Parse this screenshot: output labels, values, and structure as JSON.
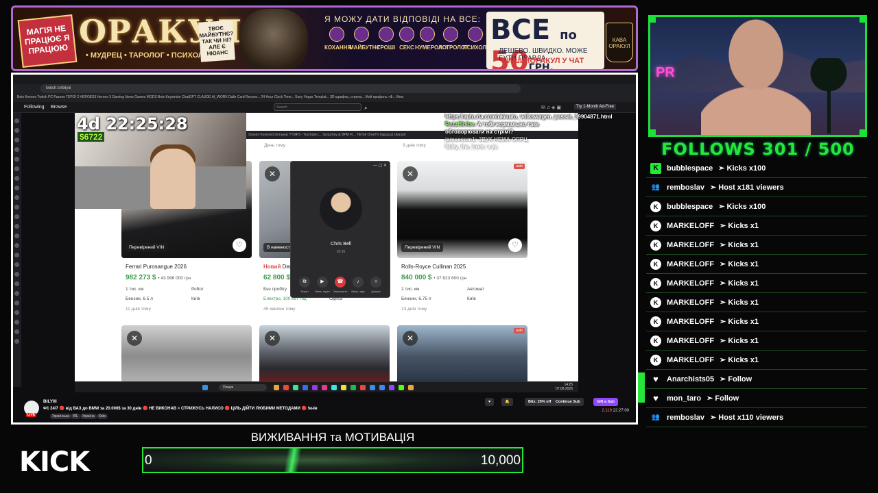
{
  "banner": {
    "left_sign": "МАГІЯ НЕ ПРАЦЮЄ Я ПРАЦЮЮ",
    "title": "ОРАКУЛ",
    "subtitle": "• МУДРЕЦ • ТАРОЛОГ • ПСИХОЛОГ •",
    "note": "ТВОЄ МАЙБУТНЄ? ТАК ЧИ НІ? АЛЕ Є НЮАНС",
    "question": "Я МОЖУ ДАТИ ВІДПОВІДІ НА ВСЕ:",
    "topics": [
      "КОХАННЯ",
      "МАЙБУТНЄ",
      "ГРОШІ",
      "СЕКС",
      "НУМЕРОЛОГ",
      "АСТРОЛОГ",
      "ПСИХОЛОГ"
    ],
    "price_all": "ВСЕ",
    "price_po": "по",
    "price_num": "50",
    "price_cur": "ГРН.",
    "price_sub": "ДЕШЕВО. ШВИДКО. МОЖЕ БУТИ ПРАВДА.",
    "price_cta": "ПИШИ !ОРАКУЛ У ЧАТ",
    "mug": "КАВА ОРАКУЛ"
  },
  "browser": {
    "url": "twitch.tv/bilyiii",
    "bookmarks": "Bets  Кпеное  Twitch  PC  Разное  ГЕРОЇ 2  HEROES3  Heroes 3  Gaming News  Games  MODS  Bots  Keystroke  ChatGPT  CLAUDE  AI_WORK  Dalle Card Recove...  24 Hour Clock Time...  Sony Vegas Templat...  3D шрифты, стрела...  Мой профиль «Ф...  films",
    "inner_tabs": "Stream  Keyword Октанер  YTMP3 - YouTube t...  Song Key & BPM Fi...  TikTok  OmeTV  kappa.ai  Ulanum"
  },
  "twitch": {
    "nav_following": "Following",
    "nav_browse": "Browse",
    "search_placeholder": "Search",
    "ad_free": "Try 1-Month Ad-Free",
    "channel": "BILYIII",
    "live": "LIVE",
    "title": "Ф1 24/7 🔴 від ВАЗ до BMW за 20.000$ за 30 днів 🔴 НЕ ВИКОНАВ = СТРИЖУСЬ НАЛИСО 🔴 ЦІЛЬ ДІЙТИ ЛЮБИМИ МЕТОДАМИ 🔴 !кнів",
    "tags": [
      "Українська",
      "IRL",
      "Україна",
      "Київ"
    ],
    "bits": "Bits: 20% off",
    "continue_sub": "Continue Sub",
    "gift_sub": "Gift a Sub",
    "viewers": "2,119",
    "uptime": "22:27:00"
  },
  "overlay": {
    "timer": "4d 22:25:28",
    "money": "$6722",
    "chat_url": "https://auto.ria.com/uk/auto_volkswagen_passat_39904871.html",
    "chat_user1": "RezziShibe:",
    "chat_msg1": "А тобі нормально таке обговорювати на стрімі?",
    "chat_user2": "jamsecom1:",
    "chat_msg2": "ЗВУК НЕМА ОПРЦ",
    "chat_user3": "bblly_the_host:",
    "chat_msg3": "з ук"
  },
  "listings": {
    "top_ago": "День тому",
    "top_ago2": "9 днів тому",
    "cards": [
      {
        "badge": "Перевірений VIN",
        "title_new": "",
        "title": "Ferrari Purosangue 2026",
        "price": "982 273 $",
        "uah": "• 43 996 000 грн",
        "mileage": "1 тис. км",
        "gear": "Робот",
        "fuel": "Бензин, 6.5 л",
        "city": "Київ",
        "ago": "11 днів тому"
      },
      {
        "badge": "В наявності",
        "title_new": "Новий",
        "title": "Denza",
        "price": "62 800 $",
        "uah": "",
        "mileage": "Без пробігу",
        "gear": "",
        "fuel": "Електро, 100 кВт·год",
        "city": "Одеса",
        "ago": "45 хвилин тому"
      },
      {
        "badge": "Перевірений VIN",
        "title_new": "",
        "title": "Rolls-Royce Cullinan 2025",
        "price": "840 000 $",
        "uah": "• 37 623 600 грн",
        "mileage": "2 тис. км",
        "gear": "Автомат",
        "fuel": "Бензин, 6.75 л",
        "city": "Київ",
        "ago": "13 днів тому"
      }
    ],
    "auto_tag": "auto"
  },
  "call": {
    "name": "Chris Bell",
    "duration": "02:36",
    "buttons": [
      "Екран",
      "Увімк. відео",
      "Завершити",
      "Вимк. звук",
      "Додати"
    ]
  },
  "taskbar": {
    "search": "Пошук",
    "time": "14:25",
    "date": "07.08.2026"
  },
  "follows": {
    "title": "FOLLOWS 301 / 500",
    "events": [
      {
        "type": "kick",
        "user": "bubblespace",
        "text": "➢ Kicks x100"
      },
      {
        "type": "host",
        "user": "remboslav",
        "text": "➢ Host x181 viewers"
      },
      {
        "type": "kick",
        "user": "bubblespace",
        "text": "➢ Kicks x100"
      },
      {
        "type": "kick",
        "user": "MARKELOFF",
        "text": "➢ Kicks x1"
      },
      {
        "type": "kick",
        "user": "MARKELOFF",
        "text": "➢ Kicks x1"
      },
      {
        "type": "kick",
        "user": "MARKELOFF",
        "text": "➢ Kicks x1"
      },
      {
        "type": "kick",
        "user": "MARKELOFF",
        "text": "➢ Kicks x1"
      },
      {
        "type": "kick",
        "user": "MARKELOFF",
        "text": "➢ Kicks x1"
      },
      {
        "type": "kick",
        "user": "MARKELOFF",
        "text": "➢ Kicks x1"
      },
      {
        "type": "kick",
        "user": "MARKELOFF",
        "text": "➢ Kicks x1"
      },
      {
        "type": "kick",
        "user": "MARKELOFF",
        "text": "➢ Kicks x1"
      },
      {
        "type": "follow",
        "user": "Anarchists05",
        "text": "➢ Follow"
      },
      {
        "type": "follow",
        "user": "mon_taro",
        "text": "➢ Follow"
      },
      {
        "type": "host",
        "user": "remboslav",
        "text": "➢ Host x110 viewers"
      }
    ]
  },
  "webcam": {
    "sign": "PR"
  },
  "bottom": {
    "logo": "KICK",
    "goal_title": "ВИЖИВАННЯ та МОТИВАЦІЯ",
    "goal_current": "0",
    "goal_max": "10,000"
  },
  "colors": {
    "accent_green": "#27e63a",
    "banner_border": "#b06ad6",
    "price_green": "#3c9a4a",
    "twitch_purple": "#9147ff"
  }
}
